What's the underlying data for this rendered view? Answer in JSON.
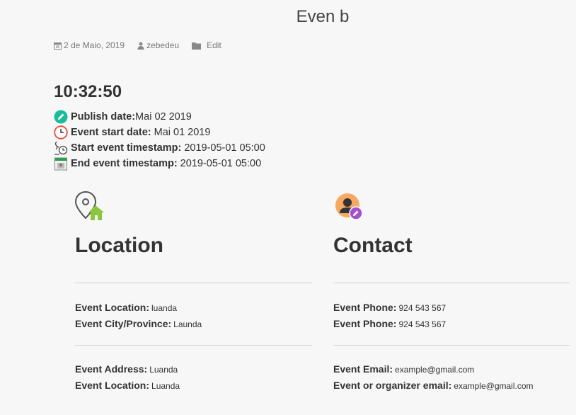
{
  "post": {
    "title": "Even b",
    "date": "2 de Maio, 2019",
    "author": "zebedeu",
    "edit_label": "Edit"
  },
  "clock": "10:32:50",
  "details": [
    {
      "icon": "pencil-icon",
      "label": "Publish date:",
      "value": "Mai 02 2019"
    },
    {
      "icon": "clock-icon",
      "label": "Event start date:",
      "value": "Mai 01 2019"
    },
    {
      "icon": "stopwatch-icon",
      "label": "Start event timestamp:",
      "value": "2019-05-01 05:00"
    },
    {
      "icon": "calendar-icon",
      "label": "End event timestamp:",
      "value": "2019-05-01 05:00"
    }
  ],
  "location": {
    "heading": "Location",
    "fields": [
      {
        "label": "Event Location:",
        "value": "luanda"
      },
      {
        "label": "Event City/Province:",
        "value": "Launda"
      },
      {
        "label": "Event Address:",
        "value": "Luanda"
      },
      {
        "label": "Event Location:",
        "value": "Luanda"
      }
    ]
  },
  "contact": {
    "heading": "Contact",
    "fields": [
      {
        "label": "Event Phone:",
        "value": "924 543 567"
      },
      {
        "label": "Event Phone:",
        "value": "924 543 567"
      },
      {
        "label": "Event Email:",
        "value": "example@gmail.com"
      },
      {
        "label": "Event or organizer email:",
        "value": "example@gmail.com"
      }
    ]
  },
  "colors": {
    "background": "#f7f7f7",
    "text": "#333333",
    "pencil_badge": "#1abc9c",
    "clock_ring": "#e74c3c",
    "location_home": "#8cc63f",
    "contact_avatar": "#f5a962",
    "contact_badge": "#a352cc"
  }
}
